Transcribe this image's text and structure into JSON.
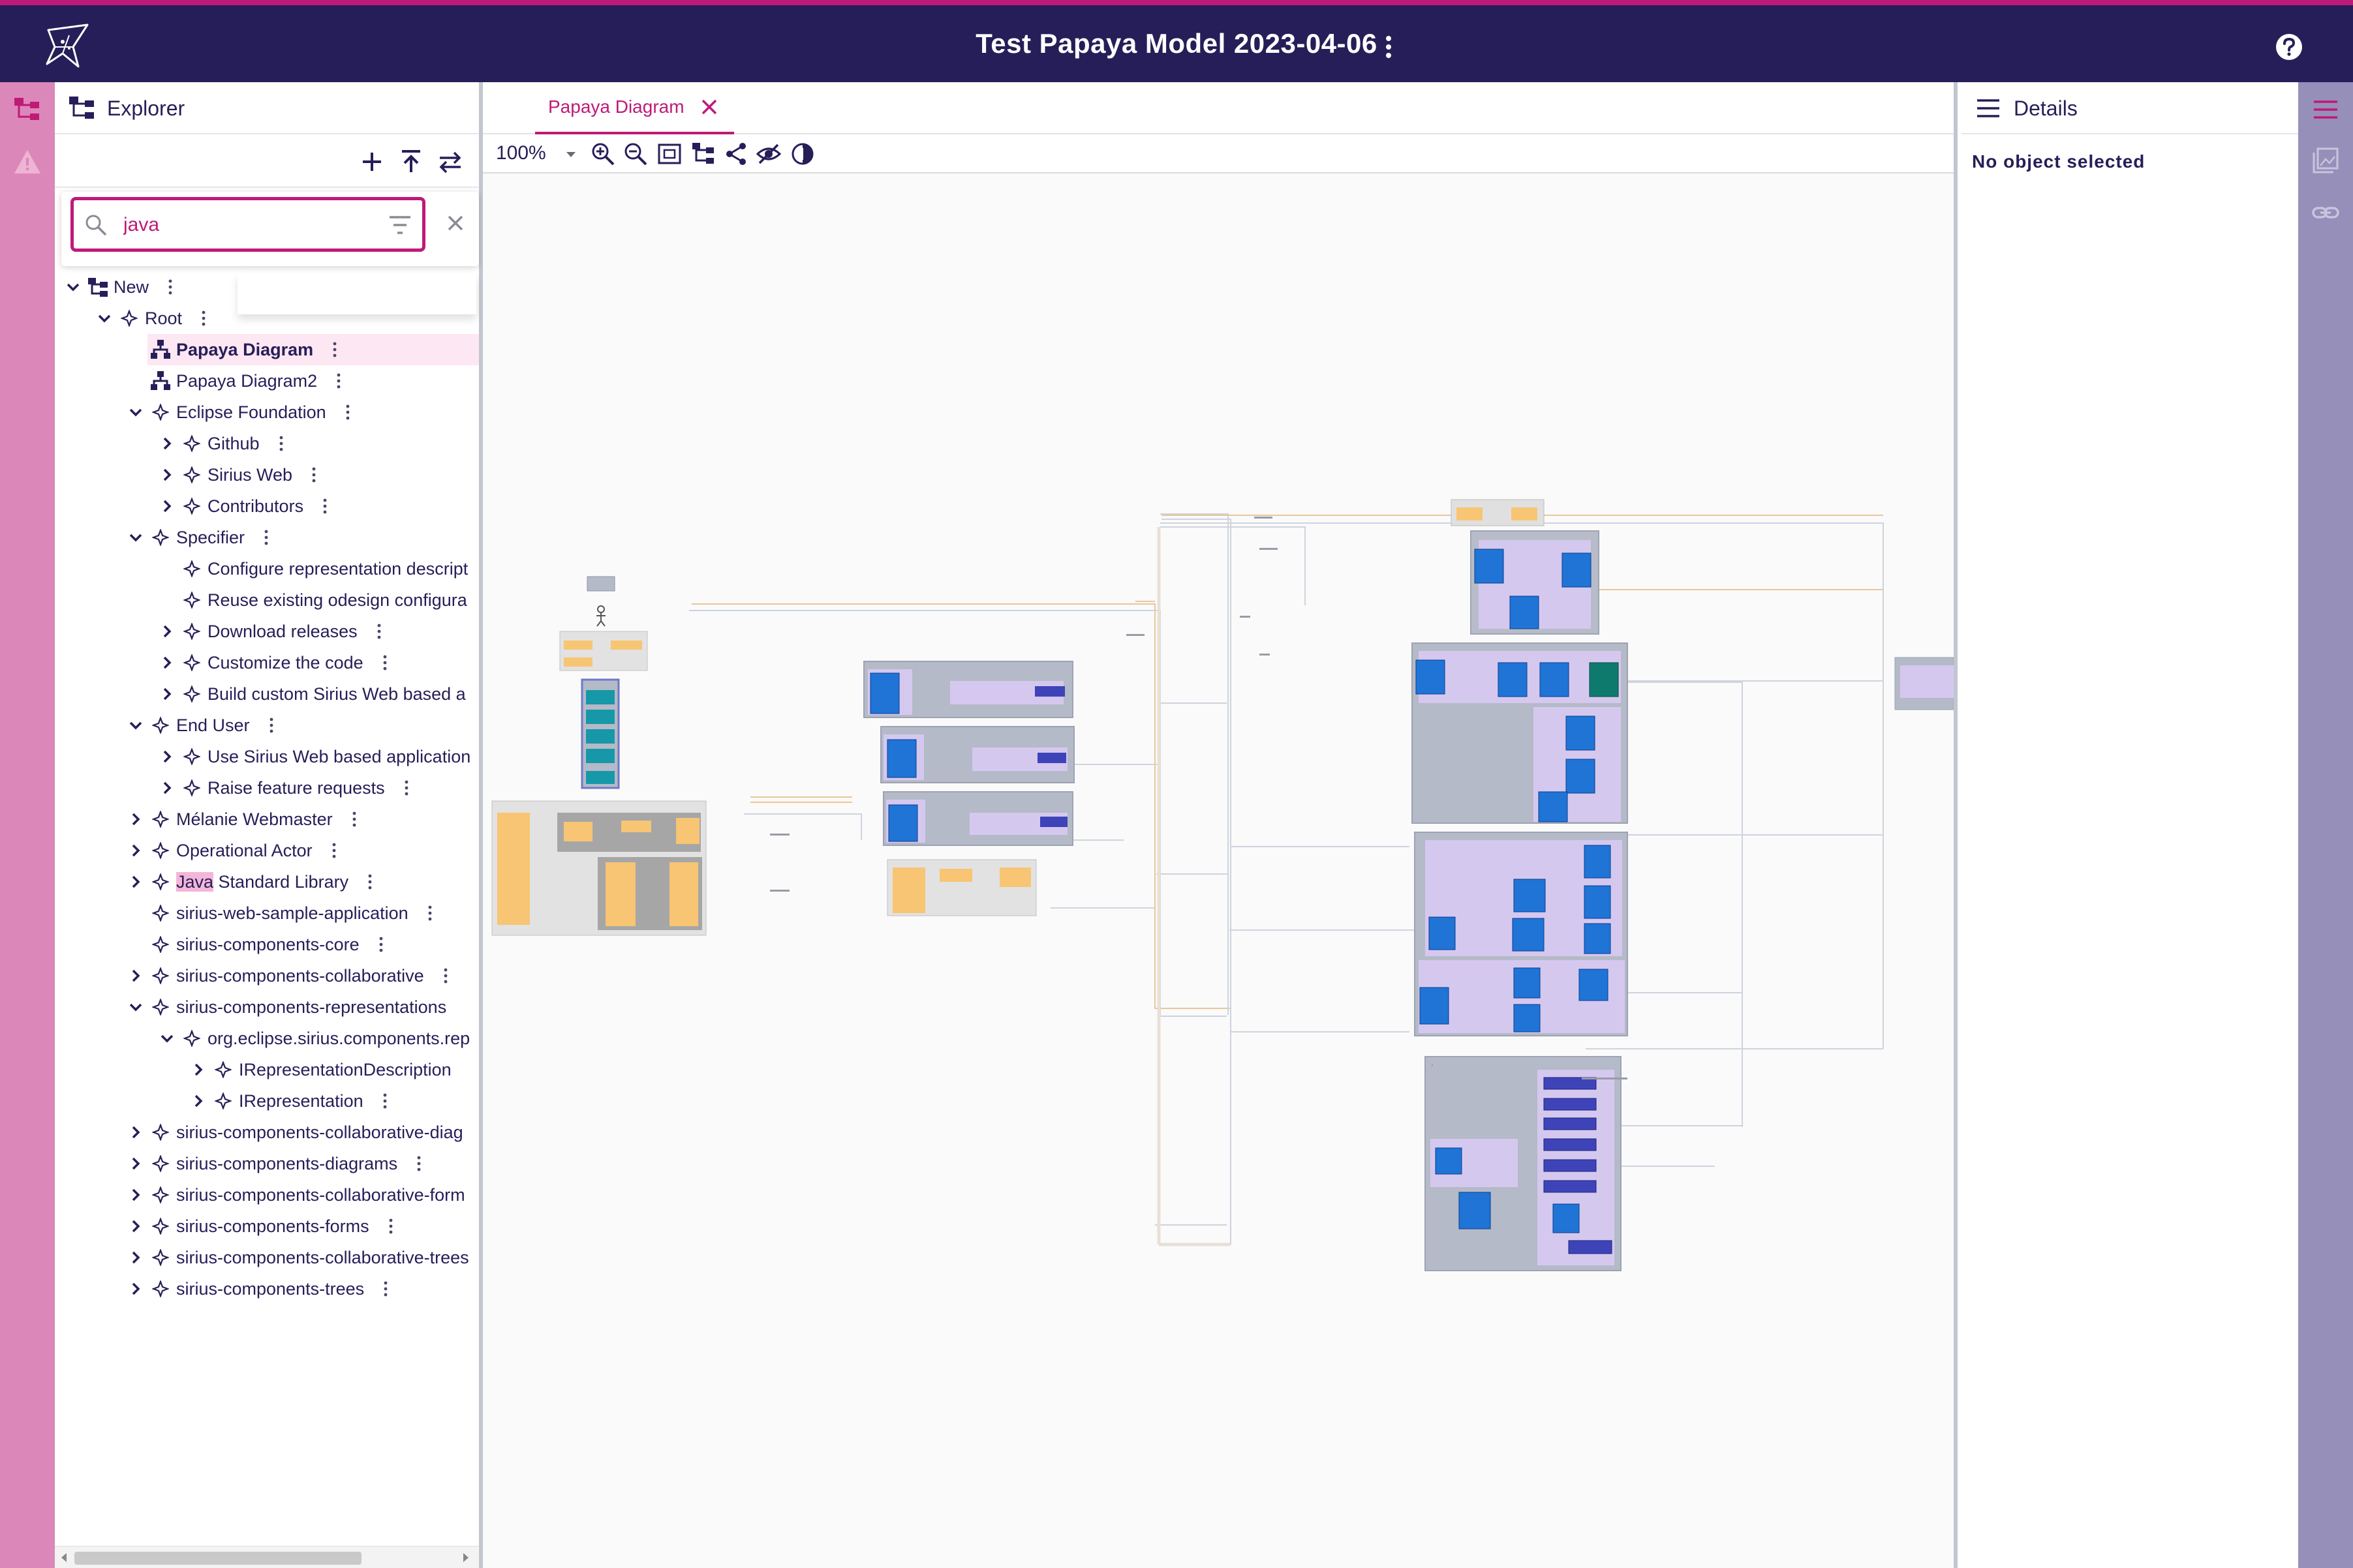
{
  "app": {
    "title": "Test Papaya Model 2023-04-06"
  },
  "icons": {
    "logo": "sirius-star-logo",
    "title_more": "more-vertical-icon",
    "help": "help-circle-icon"
  },
  "colors": {
    "header_bg": "#261e58",
    "accent": "#be1a78",
    "left_rail": "#dc87b9",
    "right_rail": "#968fba",
    "selected_row": "#fde7f2",
    "highlight": "#f4b6d8"
  },
  "explorer": {
    "title": "Explorer",
    "filter": {
      "value": "java"
    },
    "tree": [
      {
        "label": "New",
        "depth": 0,
        "chevron": "down",
        "icon": "model",
        "kebab": true
      },
      {
        "label": "Root",
        "depth": 1,
        "chevron": "down",
        "icon": "element",
        "kebab": true
      },
      {
        "label": "Papaya Diagram",
        "depth": 2,
        "chevron": "none",
        "icon": "diagram",
        "kebab": true,
        "selected": true
      },
      {
        "label": "Papaya Diagram2",
        "depth": 2,
        "chevron": "none",
        "icon": "diagram",
        "kebab": true
      },
      {
        "label": "Eclipse Foundation",
        "depth": 2,
        "chevron": "down",
        "icon": "element",
        "kebab": true
      },
      {
        "label": "Github",
        "depth": 3,
        "chevron": "right",
        "icon": "element",
        "kebab": true
      },
      {
        "label": "Sirius Web",
        "depth": 3,
        "chevron": "right",
        "icon": "element",
        "kebab": true
      },
      {
        "label": "Contributors",
        "depth": 3,
        "chevron": "right",
        "icon": "element",
        "kebab": true
      },
      {
        "label": "Specifier",
        "depth": 2,
        "chevron": "down",
        "icon": "element",
        "kebab": true
      },
      {
        "label": "Configure representation descript",
        "depth": 3,
        "chevron": "none",
        "icon": "element",
        "kebab": false
      },
      {
        "label": "Reuse existing odesign configura",
        "depth": 3,
        "chevron": "none",
        "icon": "element",
        "kebab": false
      },
      {
        "label": "Download releases",
        "depth": 3,
        "chevron": "right",
        "icon": "element",
        "kebab": true
      },
      {
        "label": "Customize the code",
        "depth": 3,
        "chevron": "right",
        "icon": "element",
        "kebab": true
      },
      {
        "label": "Build custom Sirius Web based a",
        "depth": 3,
        "chevron": "right",
        "icon": "element",
        "kebab": false
      },
      {
        "label": "End User",
        "depth": 2,
        "chevron": "down",
        "icon": "element",
        "kebab": true
      },
      {
        "label": "Use Sirius Web based application",
        "depth": 3,
        "chevron": "right",
        "icon": "element",
        "kebab": false
      },
      {
        "label": "Raise feature requests",
        "depth": 3,
        "chevron": "right",
        "icon": "element",
        "kebab": true
      },
      {
        "label": "Mélanie Webmaster",
        "depth": 2,
        "chevron": "right",
        "icon": "element",
        "kebab": true
      },
      {
        "label": "Operational Actor",
        "depth": 2,
        "chevron": "right",
        "icon": "element",
        "kebab": true
      },
      {
        "label": "Java Standard Library",
        "depth": 2,
        "chevron": "right",
        "icon": "element",
        "kebab": true,
        "match": "Java"
      },
      {
        "label": "sirius-web-sample-application",
        "depth": 2,
        "chevron": "none",
        "icon": "element",
        "kebab": true
      },
      {
        "label": "sirius-components-core",
        "depth": 2,
        "chevron": "none",
        "icon": "element",
        "kebab": true
      },
      {
        "label": "sirius-components-collaborative",
        "depth": 2,
        "chevron": "right",
        "icon": "element",
        "kebab": true
      },
      {
        "label": "sirius-components-representations",
        "depth": 2,
        "chevron": "down",
        "icon": "element",
        "kebab": false
      },
      {
        "label": "org.eclipse.sirius.components.rep",
        "depth": 3,
        "chevron": "down",
        "icon": "element",
        "kebab": false
      },
      {
        "label": "IRepresentationDescription",
        "depth": 4,
        "chevron": "right",
        "icon": "element",
        "kebab": false
      },
      {
        "label": "IRepresentation",
        "depth": 4,
        "chevron": "right",
        "icon": "element",
        "kebab": true
      },
      {
        "label": "sirius-components-collaborative-diag",
        "depth": 2,
        "chevron": "right",
        "icon": "element",
        "kebab": false
      },
      {
        "label": "sirius-components-diagrams",
        "depth": 2,
        "chevron": "right",
        "icon": "element",
        "kebab": true
      },
      {
        "label": "sirius-components-collaborative-form",
        "depth": 2,
        "chevron": "right",
        "icon": "element",
        "kebab": false
      },
      {
        "label": "sirius-components-forms",
        "depth": 2,
        "chevron": "right",
        "icon": "element",
        "kebab": true
      },
      {
        "label": "sirius-components-collaborative-trees",
        "depth": 2,
        "chevron": "right",
        "icon": "element",
        "kebab": false
      },
      {
        "label": "sirius-components-trees",
        "depth": 2,
        "chevron": "right",
        "icon": "element",
        "kebab": true
      }
    ]
  },
  "editor": {
    "tab_label": "Papaya Diagram",
    "zoom_level": "100%"
  },
  "details": {
    "title": "Details",
    "empty_message": "No object selected"
  }
}
